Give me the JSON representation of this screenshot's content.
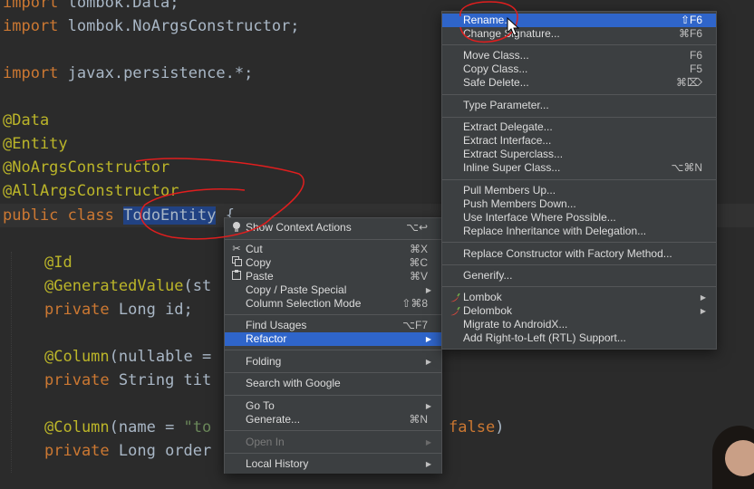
{
  "code": {
    "l1": {
      "kw": "import",
      "rest": " lombok.Data;"
    },
    "l2": {
      "kw": "import",
      "rest": " lombok.NoArgsConstructor;"
    },
    "l4": {
      "kw": "import",
      "rest": " javax.persistence.*;"
    },
    "l6": "@Data",
    "l7": "@Entity",
    "l8": "@NoArgsConstructor",
    "l9": "@AllArgsConstructor",
    "l10": {
      "kw1": "public",
      "kw2": "class",
      "name": "TodoEntity",
      "brace": " {"
    },
    "l12": "@Id",
    "l13": {
      "ann": "@GeneratedValue",
      "rest": "(st"
    },
    "l14": {
      "kw": "private",
      "rest": " Long id;"
    },
    "l16": {
      "ann": "@Column",
      "rest": "(nullable ="
    },
    "l17": {
      "kw": "private",
      "rest": " String tit"
    },
    "l19": {
      "ann": "@Column",
      "rest": "(name = ",
      "str": "\"to",
      "tail_kw": "false",
      "tail": ")"
    },
    "l20": {
      "kw": "private",
      "rest": " Long order"
    }
  },
  "context_menu": {
    "items": [
      {
        "label": "Show Context Actions",
        "shortcut": "⌥↩"
      },
      {
        "label": "Cut",
        "shortcut": "⌘X"
      },
      {
        "label": "Copy",
        "shortcut": "⌘C"
      },
      {
        "label": "Paste",
        "shortcut": "⌘V"
      },
      {
        "label": "Copy / Paste Special"
      },
      {
        "label": "Column Selection Mode",
        "shortcut": "⇧⌘8"
      },
      {
        "label": "Find Usages",
        "shortcut": "⌥F7"
      },
      {
        "label": "Refactor"
      },
      {
        "label": "Folding"
      },
      {
        "label": "Search with Google"
      },
      {
        "label": "Go To"
      },
      {
        "label": "Generate...",
        "shortcut": "⌘N"
      },
      {
        "label": "Open In"
      },
      {
        "label": "Local History"
      }
    ]
  },
  "refactor_menu": {
    "items": [
      {
        "label": "Rename...",
        "shortcut": "⇧F6"
      },
      {
        "label": "Change Signature...",
        "shortcut": "⌘F6"
      },
      {
        "label": "Move Class...",
        "shortcut": "F6"
      },
      {
        "label": "Copy Class...",
        "shortcut": "F5"
      },
      {
        "label": "Safe Delete...",
        "shortcut": "⌘⌦"
      },
      {
        "label": "Type Parameter..."
      },
      {
        "label": "Extract Delegate..."
      },
      {
        "label": "Extract Interface..."
      },
      {
        "label": "Extract Superclass..."
      },
      {
        "label": "Inline Super Class...",
        "shortcut": "⌥⌘N"
      },
      {
        "label": "Pull Members Up..."
      },
      {
        "label": "Push Members Down..."
      },
      {
        "label": "Use Interface Where Possible..."
      },
      {
        "label": "Replace Inheritance with Delegation..."
      },
      {
        "label": "Replace Constructor with Factory Method..."
      },
      {
        "label": "Generify..."
      },
      {
        "label": "Lombok"
      },
      {
        "label": "Delombok"
      },
      {
        "label": "Migrate to AndroidX..."
      },
      {
        "label": "Add Right-to-Left (RTL) Support..."
      }
    ]
  },
  "colors": {
    "editor_bg": "#2b2b2b",
    "menu_bg": "#3c3f41",
    "selection": "#2f65ca",
    "keyword": "#cc7832",
    "annotation": "#bbb529",
    "string": "#6a8759",
    "pen": "#e01e1e"
  }
}
